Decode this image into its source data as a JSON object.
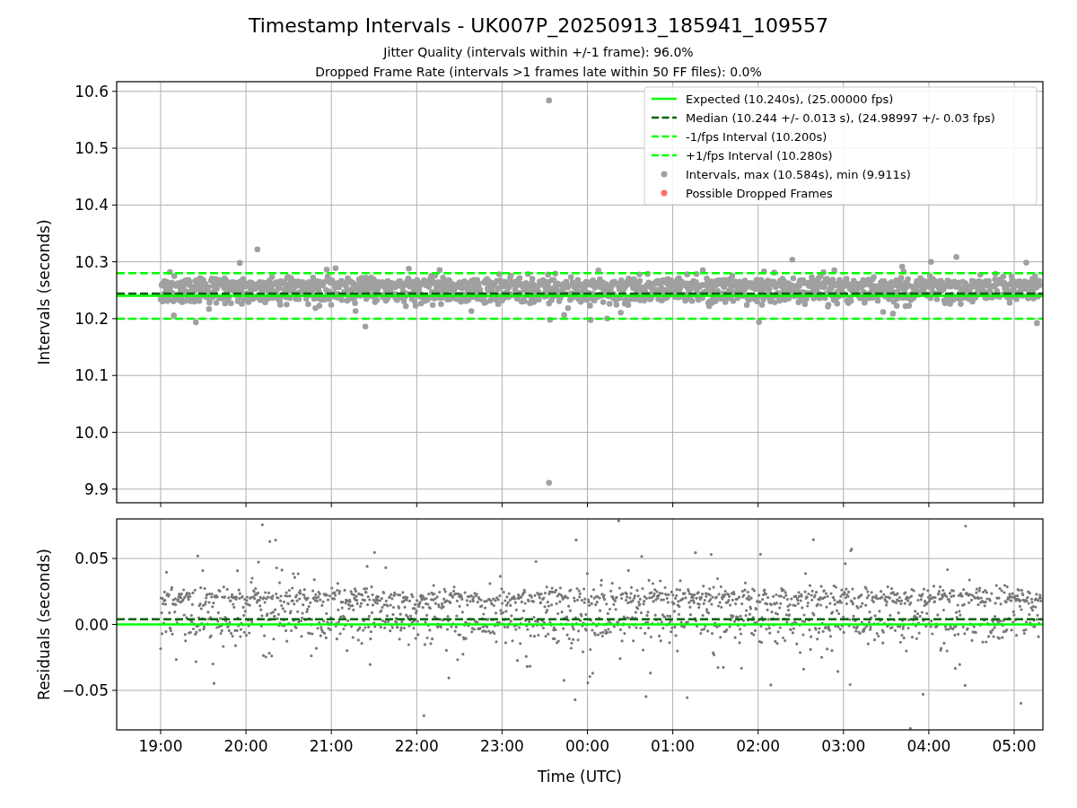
{
  "figure": {
    "title": "Timestamp Intervals - UK007P_20250913_185941_109557",
    "subtitles": [
      "Jitter Quality (intervals within +/-1 frame): 96.0%",
      "Dropped Frame Rate (intervals >1 frames late within 50 FF files): 0.0%"
    ]
  },
  "panels": [
    {
      "chart_data": {
        "type": "scatter",
        "ylabel": "Intervals (seconds)",
        "ylim": [
          9.876,
          10.617
        ],
        "grid": true,
        "legend": "upper right",
        "yticks": [
          {
            "value": 9.9,
            "label": "9.9"
          },
          {
            "value": 10.0,
            "label": "10.0"
          },
          {
            "value": 10.1,
            "label": "10.1"
          },
          {
            "value": 10.2,
            "label": "10.2"
          },
          {
            "value": 10.3,
            "label": "10.3"
          },
          {
            "value": 10.4,
            "label": "10.4"
          },
          {
            "value": 10.5,
            "label": "10.5"
          },
          {
            "value": 10.6,
            "label": "10.6"
          }
        ],
        "ref_lines": [
          {
            "axis": "y",
            "value": 10.24,
            "label": "Expected (10.240s), (25.00000 fps)",
            "color": "#00ff00"
          },
          {
            "axis": "y",
            "value": 10.244,
            "label": "Median (10.244 +/- 0.013 s), (24.98997 +/- 0.03 fps)",
            "color": "#006400"
          },
          {
            "axis": "y",
            "value": 10.2,
            "label": "-1/fps Interval (10.200s)",
            "color": "#00ff00"
          },
          {
            "axis": "y",
            "value": 10.28,
            "label": "+1/fps Interval (10.280s)",
            "color": "#00ff00"
          }
        ],
        "series": [
          {
            "name": "Intervals, max (10.584s), min (9.911s)",
            "color": "#a0a0a0"
          },
          {
            "name": "Possible Dropped Frames",
            "color": "#ff6b6b"
          }
        ]
      }
    },
    {
      "chart_data": {
        "type": "scatter",
        "xlabel": "Time (UTC)",
        "ylabel": "Residuals (seconds)",
        "ylim": [
          -0.08,
          0.08
        ],
        "grid": true,
        "categories": [
          "19:00",
          "20:00",
          "21:00",
          "22:00",
          "23:00",
          "00:00",
          "01:00",
          "02:00",
          "03:00",
          "04:00",
          "05:00"
        ],
        "yticks": [
          {
            "value": -0.05,
            "label": "−0.05"
          },
          {
            "value": 0,
            "label": "0.00"
          },
          {
            "value": 0.05,
            "label": "0.05"
          }
        ],
        "ref_lines": [
          {
            "axis": "y",
            "value": 0,
            "color": "#00ff00"
          },
          {
            "axis": "y",
            "value": 0.004,
            "color": "#006400"
          }
        ]
      }
    }
  ]
}
